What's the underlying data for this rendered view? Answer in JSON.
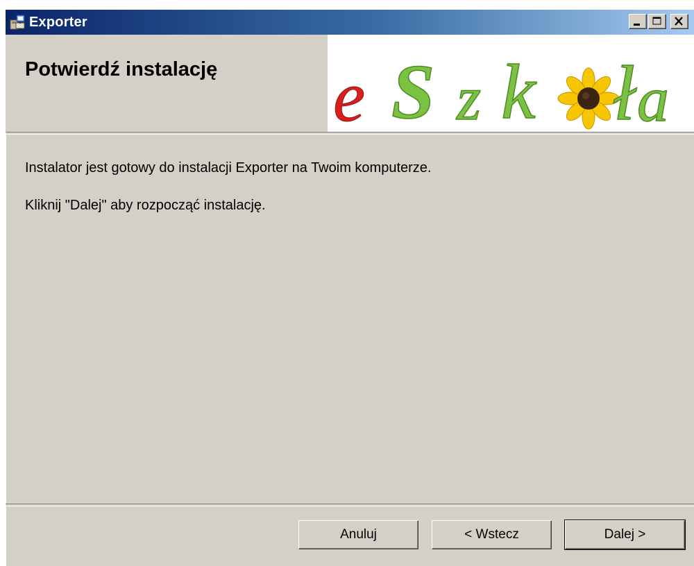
{
  "window": {
    "title": "Exporter",
    "app_icon": "installer-icon",
    "controls": {
      "minimize": "minimize-icon",
      "maximize": "maximize-icon",
      "close": "close-icon"
    }
  },
  "header": {
    "title": "Potwierdź instalację",
    "logo_text": "eSzkoła",
    "logo_colors": {
      "e": "#d91e1e",
      "rest": "#7cc242",
      "flower_petals": "#f7c600",
      "flower_center": "#3b2412"
    }
  },
  "body": {
    "line1": "Instalator jest gotowy do instalacji Exporter na Twoim komputerze.",
    "line2": "Kliknij \"Dalej\" aby rozpocząć instalację."
  },
  "buttons": {
    "cancel": "Anuluj",
    "back": "< Wstecz",
    "next": "Dalej >"
  }
}
